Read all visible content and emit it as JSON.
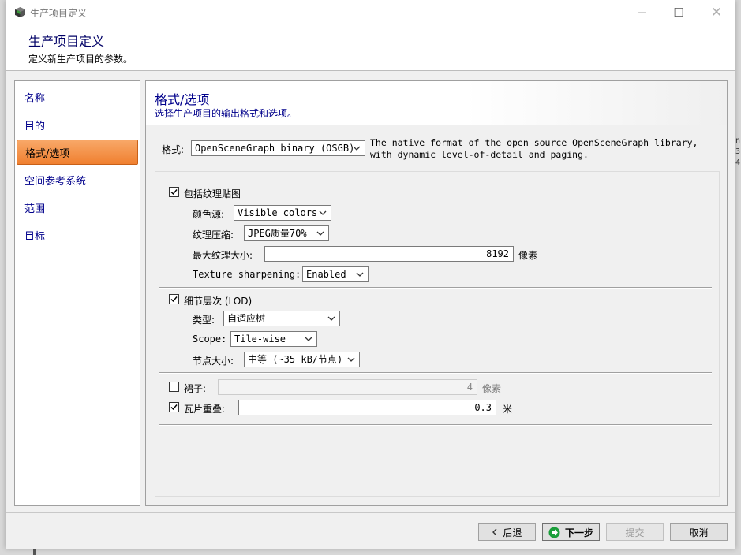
{
  "window": {
    "title": "生产项目定义",
    "min_glyph": "—",
    "max_glyph": "☐",
    "close_glyph": "✕",
    "app_icon": "cube-icon"
  },
  "header": {
    "title": "生产项目定义",
    "subtitle": "定义新生产项目的参数。"
  },
  "nav": {
    "items": [
      {
        "label": "名称",
        "selected": false
      },
      {
        "label": "目的",
        "selected": false
      },
      {
        "label": "格式/选项",
        "selected": true
      },
      {
        "label": "空间参考系统",
        "selected": false
      },
      {
        "label": "范围",
        "selected": false
      },
      {
        "label": "目标",
        "selected": false
      }
    ]
  },
  "content": {
    "title": "格式/选项",
    "subtitle": "选择生产项目的输出格式和选项。",
    "format": {
      "label": "格式:",
      "value": "OpenSceneGraph binary (OSGB)",
      "description": "The native format of the open source OpenSceneGraph library, with dynamic level-of-detail and paging."
    },
    "textures": {
      "checked": true,
      "label": "包括纹理贴图",
      "color_source": {
        "label": "颜色源:",
        "value": "Visible colors"
      },
      "compression": {
        "label": "纹理压缩:",
        "value": "JPEG质量70%"
      },
      "max_size": {
        "label": "最大纹理大小:",
        "value": "8192",
        "unit": "像素"
      },
      "sharpening": {
        "label": "Texture sharpening:",
        "value": "Enabled"
      }
    },
    "lod": {
      "checked": true,
      "label": "细节层次 (LOD)",
      "type": {
        "label": "类型:",
        "value": "自适应树"
      },
      "scope": {
        "label": "Scope:",
        "value": "Tile-wise"
      },
      "node_size": {
        "label": "节点大小:",
        "value": "中等 (~35 kB/节点)"
      }
    },
    "skirt": {
      "checked": false,
      "label": "裙子:",
      "value": "4",
      "unit": "像素"
    },
    "tile_overlap": {
      "checked": true,
      "label": "瓦片重叠:",
      "value": "0.3",
      "unit": "米"
    }
  },
  "footer": {
    "back": "后退",
    "next": "下一步",
    "submit": "提交",
    "cancel": "取消"
  },
  "background": {
    "side_text": "n\n3\n4"
  },
  "colors": {
    "nav_text": "#00008b",
    "selected_nav": "#f08030",
    "next_icon": "#1a9e3a"
  }
}
